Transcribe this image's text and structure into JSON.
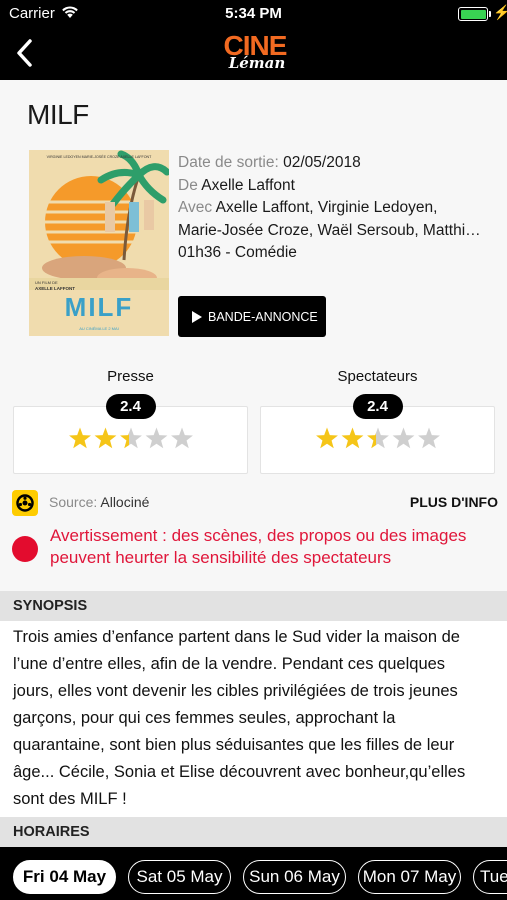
{
  "status_bar": {
    "carrier": "Carrier",
    "time": "5:34 PM"
  },
  "header": {
    "logo_primary": "CINE",
    "logo_secondary": "Léman"
  },
  "movie": {
    "title": "MILF",
    "release_label": "Date de sortie:",
    "release_date": "02/05/2018",
    "director_label": "De",
    "director": "Axelle Laffont",
    "cast_label": "Avec",
    "cast_line1": "Axelle Laffont, Virginie Ledoyen,",
    "cast_line2": "Marie-Josée Croze, Waël Sersoub, Matthi…",
    "duration_genre": "01h36 - Comédie",
    "trailer_label": "BANDE-ANNONCE",
    "poster": {
      "top_credits": "VIRGINIE LEDOYEN   MARIE-JOSÉE CROZE   AXELLE LAFFONT",
      "byline": "UN FILM DE",
      "byline_name": "AXELLE LAFFONT",
      "title": "MILF",
      "release": "AU CINÉMA LE 2 MAI"
    }
  },
  "ratings": [
    {
      "label": "Presse",
      "score": "2.4",
      "stars": 2.4,
      "max": 5
    },
    {
      "label": "Spectateurs",
      "score": "2.4",
      "stars": 2.4,
      "max": 5
    }
  ],
  "source": {
    "label": "Source:",
    "name": "Allociné",
    "more_info": "PLUS D'INFO"
  },
  "warning": {
    "line1": "Avertissement : des scènes, des propos ou des images",
    "line2": "peuvent heurter la sensibilité des spectateurs"
  },
  "synopsis": {
    "heading": "SYNOPSIS",
    "lines": [
      "Trois amies d’enfance partent dans le Sud vider la maison de",
      "l’une d’entre elles, afin de la vendre. Pendant ces quelques",
      "jours, elles vont devenir les cibles privilégiées de trois jeunes",
      "garçons, pour qui ces femmes seules, approchant la",
      "quarantaine, sont bien plus séduisantes que les filles de leur",
      "âge... Cécile, Sonia et Elise découvrent avec bonheur,qu’elles",
      "sont des MILF !"
    ]
  },
  "schedule": {
    "heading": "HORAIRES",
    "dates": [
      {
        "label": "Fri 04 May",
        "active": true
      },
      {
        "label": "Sat 05 May",
        "active": false
      },
      {
        "label": "Sun 06 May",
        "active": false
      },
      {
        "label": "Mon 07 May",
        "active": false
      },
      {
        "label": "Tue",
        "active": false
      }
    ]
  },
  "colors": {
    "accent_orange": "#f26a21",
    "warning_red": "#e0163a",
    "star_gold": "#f5c518",
    "star_empty": "#cfcfcf",
    "allocine_yellow": "#fecc00"
  }
}
